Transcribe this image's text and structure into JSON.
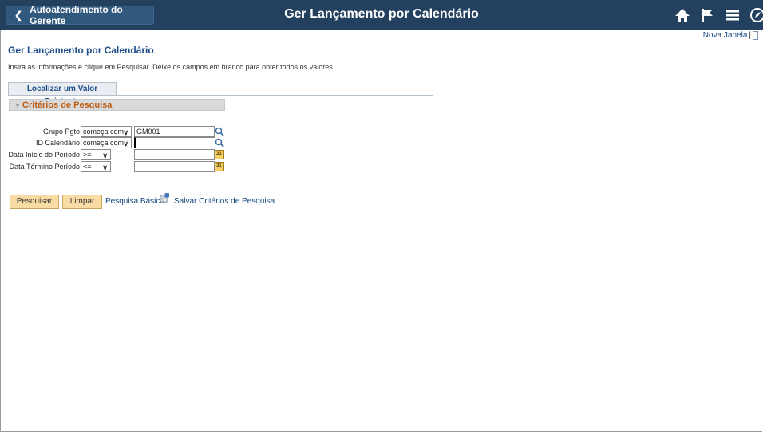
{
  "header": {
    "back_label": "Autoatendimento do Gerente",
    "title": "Ger Lançamento por Calendário",
    "icons": [
      "home-icon",
      "flag-icon",
      "menu-icon",
      "navbar-icon"
    ]
  },
  "top_links": {
    "new_window": "Nova Janela",
    "separator": "|"
  },
  "page": {
    "title": "Ger Lançamento por Calendário",
    "instructions": "Insira as informações e clique em Pesquisar. Deixe os campos em branco para obter todos os valores.",
    "tab_label": "Localizar um Valor Existente",
    "section_label": "Critérios de Pesquisa"
  },
  "fields": {
    "grupo_pgto": {
      "label": "Grupo Pgto",
      "operator": "começa com",
      "value": "GM001"
    },
    "id_calendario": {
      "label": "ID Calendário",
      "operator": "começa com",
      "value": ""
    },
    "data_inicio": {
      "label": "Data Início do Período",
      "operator": ">=",
      "value": ""
    },
    "data_termino": {
      "label": "Data Término Período",
      "operator": "<=",
      "value": ""
    }
  },
  "actions": {
    "search": "Pesquisar",
    "clear": "Limpar",
    "basic_search": "Pesquisa Básica",
    "save_criteria": "Salvar Critérios de Pesquisa"
  }
}
